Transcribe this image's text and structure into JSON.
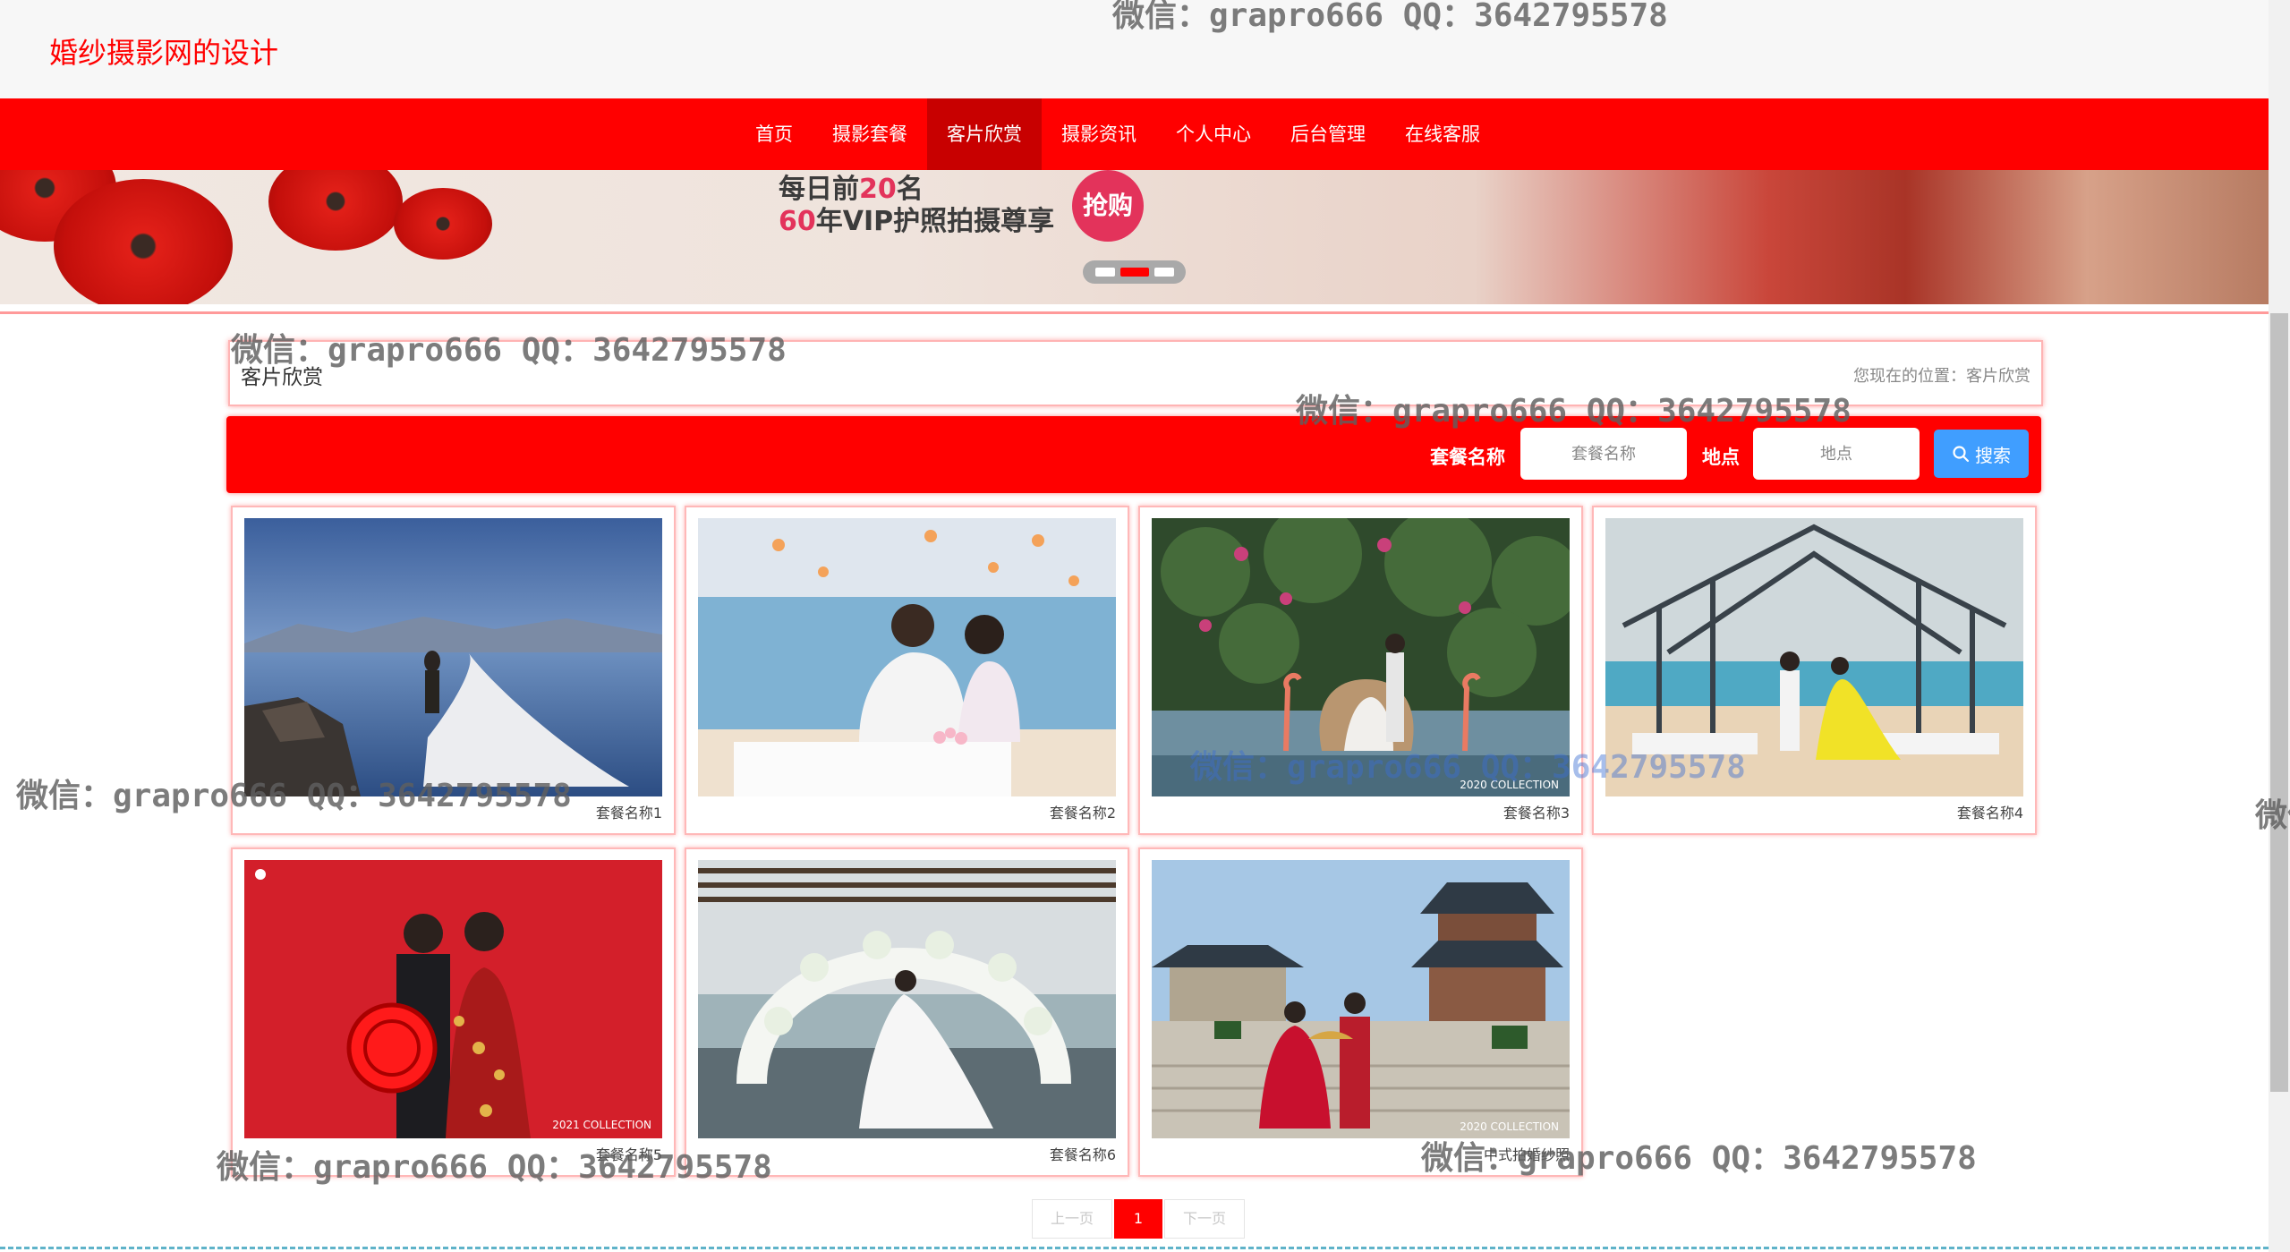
{
  "header": {
    "site_title": "婚纱摄影网的设计"
  },
  "nav": {
    "items": [
      {
        "label": "首页"
      },
      {
        "label": "摄影套餐"
      },
      {
        "label": "客片欣赏"
      },
      {
        "label": "摄影资讯"
      },
      {
        "label": "个人中心"
      },
      {
        "label": "后台管理"
      },
      {
        "label": "在线客服"
      }
    ],
    "active_index": 2
  },
  "banner": {
    "line1_prefix": "每日前",
    "line1_number": "20",
    "line1_suffix": "名",
    "line2_number": "60",
    "line2_suffix": "年VIP护照拍摄尊享",
    "badge": "抢购",
    "slide_count": 3,
    "active_slide": 2
  },
  "breadcrumb": {
    "title": "客片欣赏",
    "location": "您现在的位置：客片欣赏"
  },
  "search": {
    "name_label": "套餐名称",
    "name_placeholder": "套餐名称",
    "location_label": "地点",
    "location_placeholder": "地点",
    "button_label": "搜索",
    "button_icon": "search-icon"
  },
  "gallery": [
    {
      "name": "套餐名称1",
      "photo_caption": ""
    },
    {
      "name": "套餐名称2",
      "photo_caption": ""
    },
    {
      "name": "套餐名称3",
      "photo_caption": "2020 COLLECTION"
    },
    {
      "name": "套餐名称4",
      "photo_caption": ""
    },
    {
      "name": "套餐名称5",
      "photo_caption": "2021 COLLECTION"
    },
    {
      "name": "套餐名称6",
      "photo_caption": ""
    },
    {
      "name": "中式拍婚纱照",
      "photo_caption": "2020 COLLECTION"
    }
  ],
  "pagination": {
    "prev": "上一页",
    "current": "1",
    "next": "下一页"
  },
  "watermark": {
    "text": "微信：grapro666 QQ：3642795578"
  },
  "colors": {
    "brand_red": "#ff0000",
    "nav_active": "#c80000",
    "search_button": "#409eff"
  }
}
